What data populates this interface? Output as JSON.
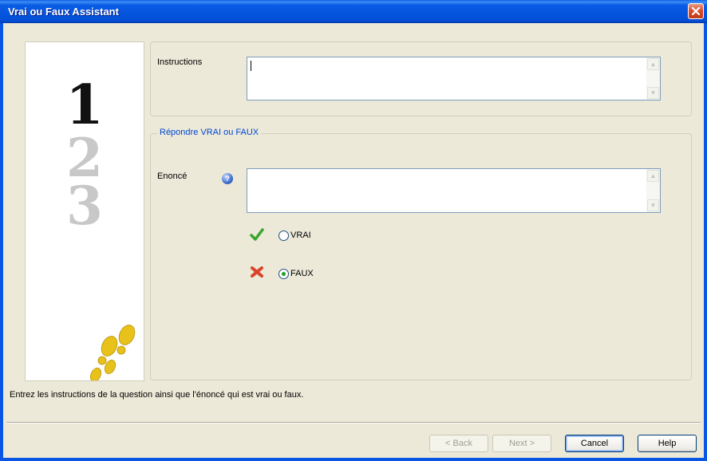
{
  "window": {
    "title": "Vrai ou Faux Assistant"
  },
  "side_panel": {
    "steps": [
      "1",
      "2",
      "3"
    ],
    "active_step": 1
  },
  "instructions": {
    "label": "Instructions",
    "value": ""
  },
  "group": {
    "legend": "Répondre VRAI ou FAUX",
    "enonce_label": "Enoncé",
    "enonce_value": "",
    "options": [
      {
        "label": "VRAI",
        "checked": false,
        "icon": "check-icon"
      },
      {
        "label": "FAUX",
        "checked": true,
        "icon": "cross-icon"
      }
    ]
  },
  "status": "Entrez les instructions de la question ainsi que l'énoncé qui est vrai ou faux.",
  "buttons": {
    "back": "< Back",
    "next": "Next >",
    "cancel": "Cancel",
    "help": "Help"
  },
  "colors": {
    "title_bar": "#0A55E4",
    "dialog_bg": "#ECE9D8",
    "legend": "#0046D5",
    "check": "#39A52E",
    "cross": "#D9432A",
    "footprints": "#E8C21A"
  }
}
